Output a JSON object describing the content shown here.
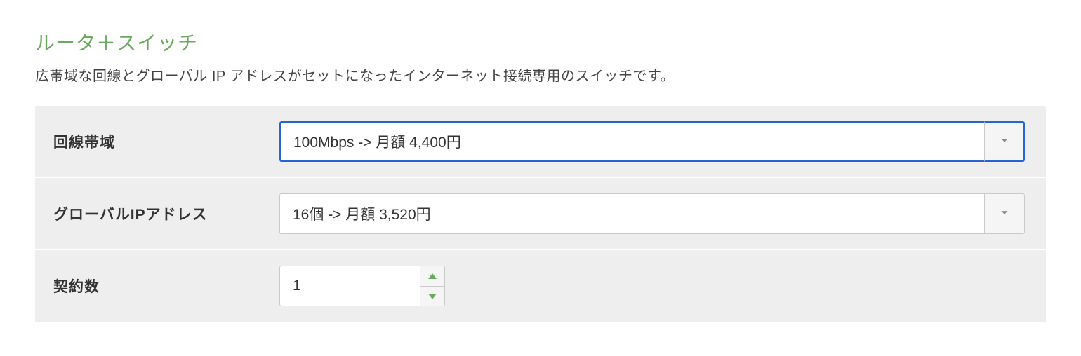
{
  "section": {
    "title": "ルータ＋スイッチ",
    "description": "広帯域な回線とグローバル IP アドレスがセットになったインターネット接続専用のスイッチです。"
  },
  "form": {
    "bandwidth": {
      "label": "回線帯域",
      "value": "100Mbps -> 月額 4,400円"
    },
    "global_ip": {
      "label": "グローバルIPアドレス",
      "value": "16個 -> 月額 3,520円"
    },
    "quantity": {
      "label": "契約数",
      "value": "1"
    }
  }
}
